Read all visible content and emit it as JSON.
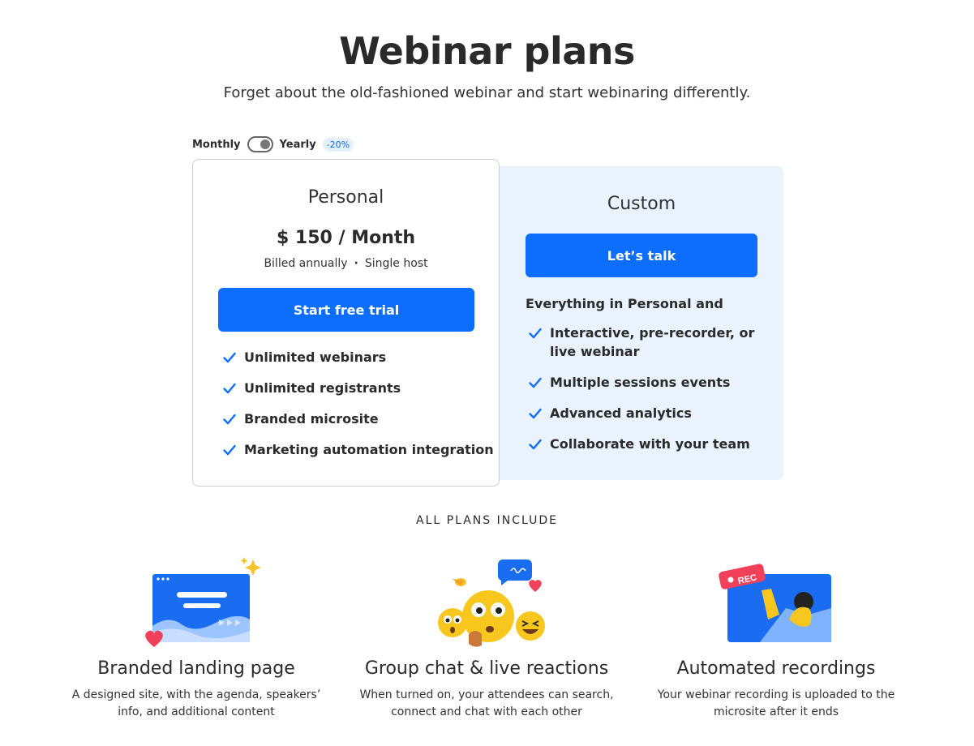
{
  "header": {
    "title": "Webinar plans",
    "subtitle": "Forget about the old-fashioned webinar and start webinaring differently."
  },
  "billing_toggle": {
    "monthly_label": "Monthly",
    "yearly_label": "Yearly",
    "discount_badge": "-20%",
    "selected": "Yearly"
  },
  "plans": {
    "personal": {
      "name": "Personal",
      "price": "$ 150 / Month",
      "billed": "Billed annually",
      "separator": "·",
      "hosts": "Single host",
      "cta": "Start free trial",
      "features": [
        "Unlimited webinars",
        "Unlimited registrants",
        "Branded microsite",
        "Marketing automation integration"
      ]
    },
    "custom": {
      "name": "Custom",
      "cta": "Let’s talk",
      "intro": "Everything in Personal and",
      "features": [
        "Interactive, pre-recorder, or live webinar",
        "Multiple sessions events",
        "Advanced analytics",
        "Collaborate with your team"
      ]
    }
  },
  "all_plans": {
    "heading": "ALL PLANS INCLUDE",
    "items": [
      {
        "title": "Branded landing page",
        "description": "A designed site, with the agenda, speakers’ info, and additional content",
        "icon": "landing-page-illustration"
      },
      {
        "title": "Group chat & live reactions",
        "description": "When turned on, your attendees can search, connect and chat with each other",
        "icon": "chat-reactions-illustration"
      },
      {
        "title": "Automated recordings",
        "description": "Your webinar recording is uploaded to the microsite after it ends",
        "icon": "recording-illustration",
        "rec_label": "REC"
      }
    ]
  },
  "colors": {
    "primary": "#0d6efd",
    "custom_card_bg": "#eaf2fd",
    "check": "#0d6efd",
    "text": "#2b2b2b"
  }
}
